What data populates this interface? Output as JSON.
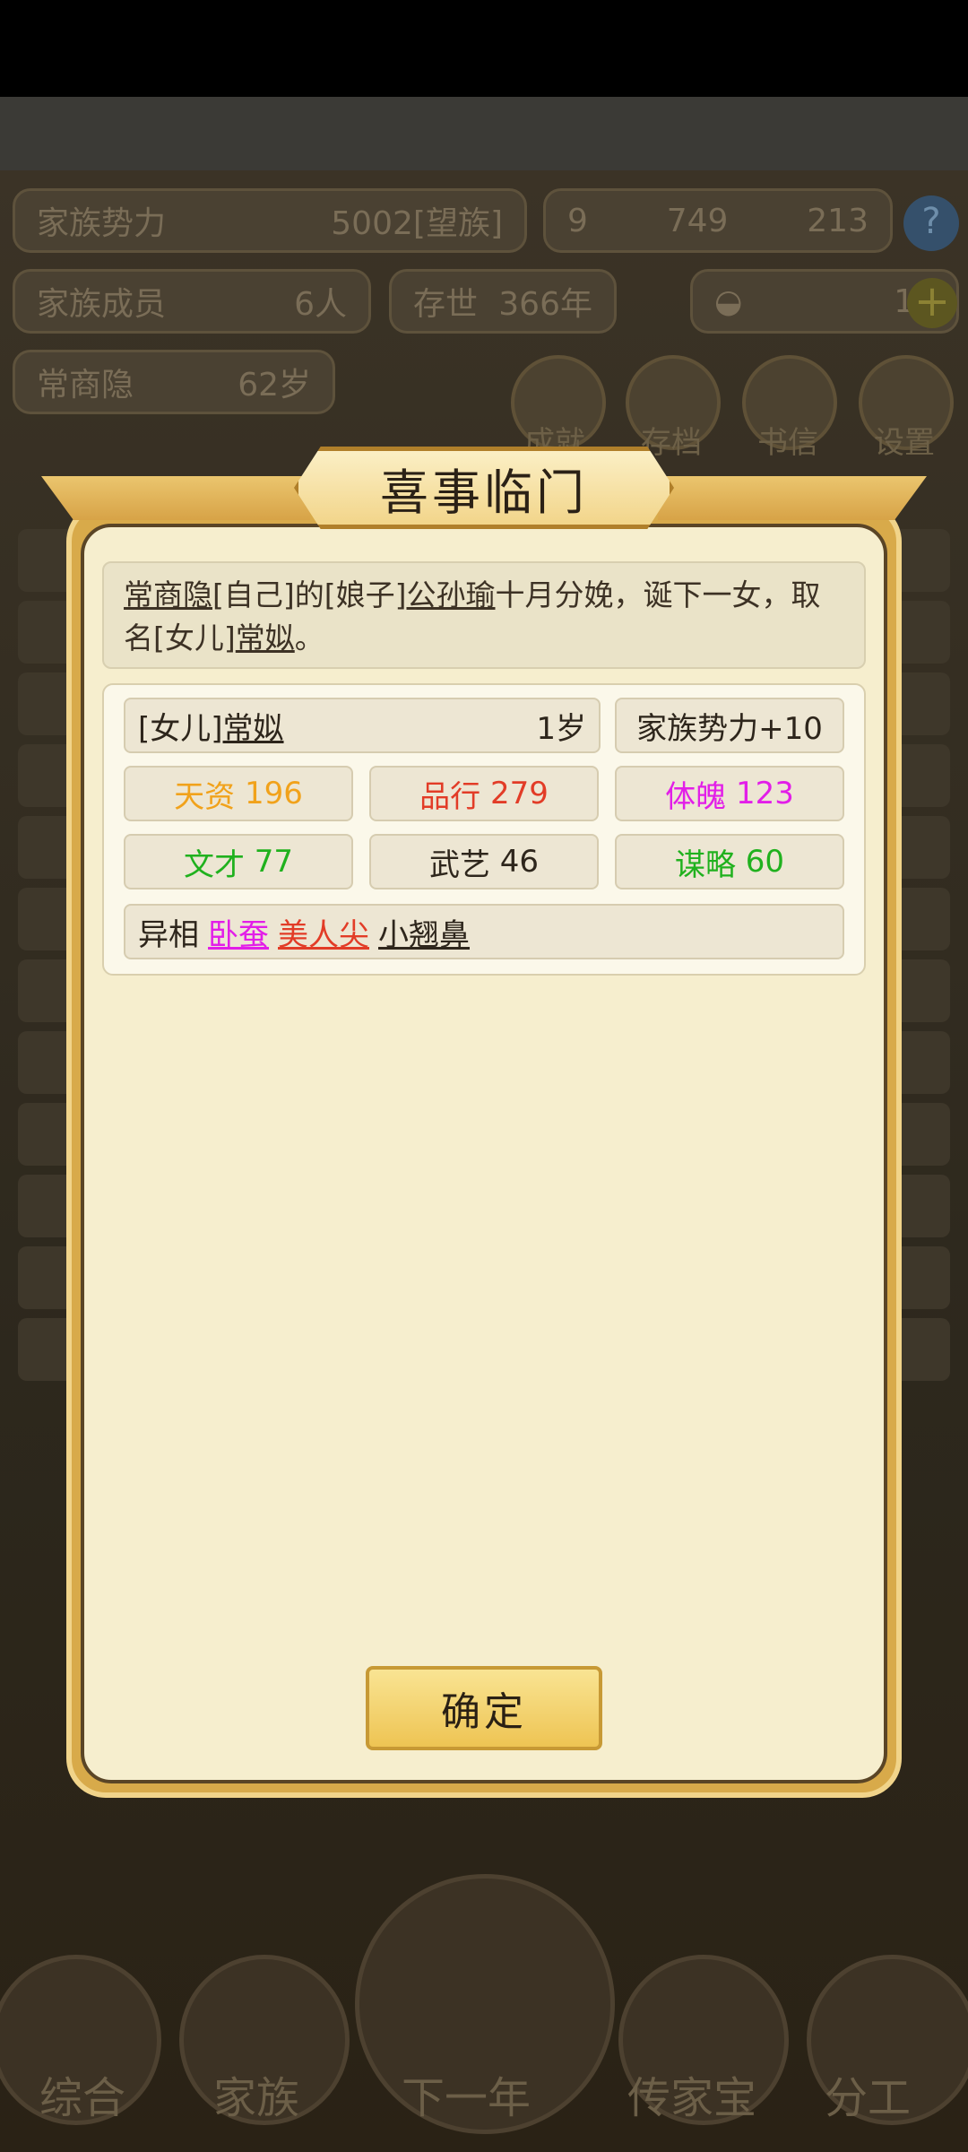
{
  "background": {
    "family_power_label": "家族势力",
    "family_power_value": "5002",
    "family_power_rank": "[望族]",
    "currency_a": "9",
    "currency_b": "749",
    "currency_c": "213",
    "help_label": "?",
    "members_label": "家族成员",
    "members_value": "6人",
    "existence_label": "存世",
    "existence_value": "366年",
    "gold_value": "13",
    "plus_label": "+",
    "leader_name": "常商隐",
    "leader_age": "62岁",
    "menu": [
      "成就",
      "存档",
      "书信",
      "设置"
    ],
    "bottom_nav": [
      "综合",
      "家族",
      "下一年",
      "传家宝",
      "分工"
    ]
  },
  "dialog": {
    "title": "喜事临门",
    "message": {
      "p1": "常商隐",
      "p2": "[自己]的[娘子]",
      "p3": "公孙瑜",
      "p4": "十月分娩，诞下一女，取名[女儿]",
      "p5": "常姒",
      "p6": "。"
    },
    "child": {
      "relation": "[女儿]",
      "name": "常姒",
      "age": "1岁",
      "power_bonus": "家族势力+10"
    },
    "stats": [
      {
        "label": "天资",
        "value": "196",
        "color": "#f1a21b"
      },
      {
        "label": "品行",
        "value": "279",
        "color": "#e23c27"
      },
      {
        "label": "体魄",
        "value": "123",
        "color": "#e21ee8"
      },
      {
        "label": "文才",
        "value": "77",
        "color": "#20b11e"
      },
      {
        "label": "武艺",
        "value": "46",
        "color": "#2e261c"
      },
      {
        "label": "谋略",
        "value": "60",
        "color": "#20b11e"
      }
    ],
    "traits_label": "异相",
    "traits": [
      {
        "name": "卧蚕",
        "color": "#e21ee8"
      },
      {
        "name": "美人尖",
        "color": "#e23c27"
      },
      {
        "name": "小翘鼻",
        "color": "#2d251b"
      }
    ],
    "confirm_label": "确定"
  }
}
